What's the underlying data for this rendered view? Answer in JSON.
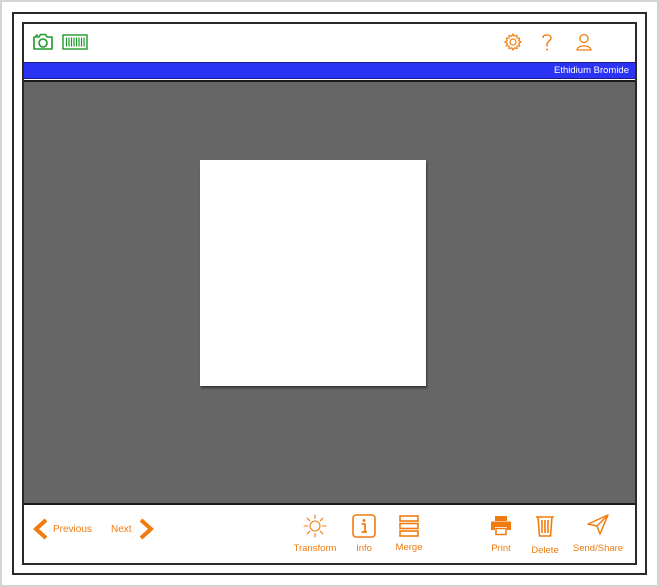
{
  "header": {
    "title": "Ethidium Bromide",
    "left_icons": [
      "camera-icon",
      "barcode-icon"
    ],
    "right_icons": [
      "gear-icon",
      "help-icon",
      "user-icon"
    ]
  },
  "footer": {
    "previous_label": "Previous",
    "next_label": "Next",
    "tools": {
      "transform": "Transform",
      "info": "Info",
      "merge": "Merge",
      "print": "Print",
      "delete": "Delete",
      "send_share": "Send/Share"
    }
  },
  "colors": {
    "accent": "#f07c10",
    "green_icons": "#1e9a2a",
    "title_bar": "#2b33f5",
    "viewer_bg": "#666666"
  }
}
